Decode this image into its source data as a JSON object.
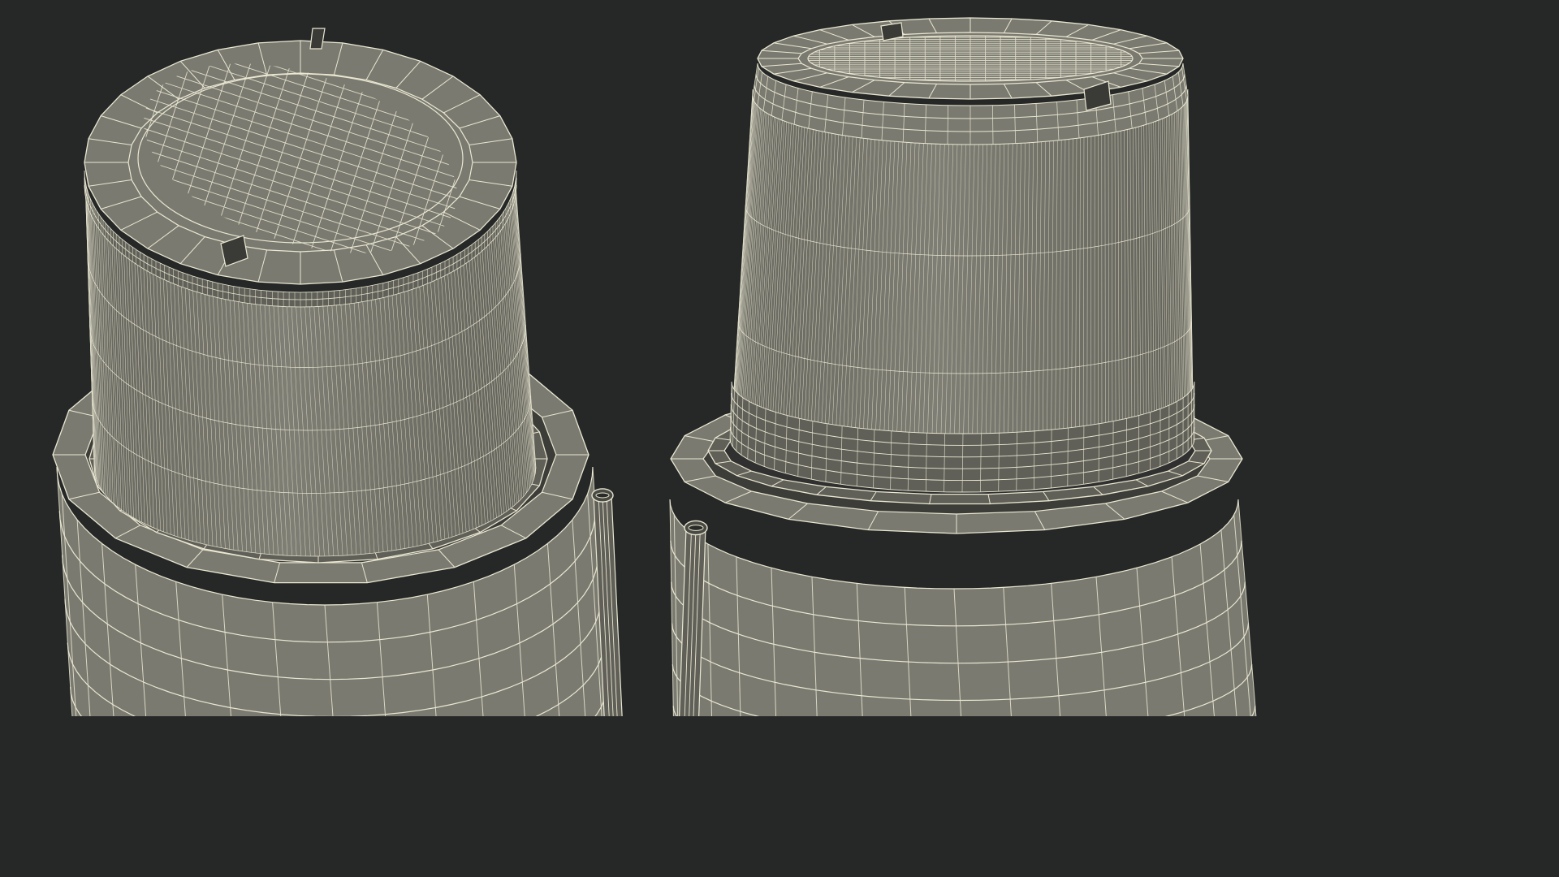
{
  "scene": {
    "background_color": "#262828",
    "mesh_fill_color": "#7a7a70",
    "mesh_shade_color": "#606058",
    "mesh_dark_color": "#4a4a44",
    "wire_color": "#eae7d2",
    "models": [
      {
        "name": "wireframe-container-left",
        "view": "top-oblique"
      },
      {
        "name": "wireframe-container-right",
        "view": "front-oblique"
      }
    ]
  }
}
